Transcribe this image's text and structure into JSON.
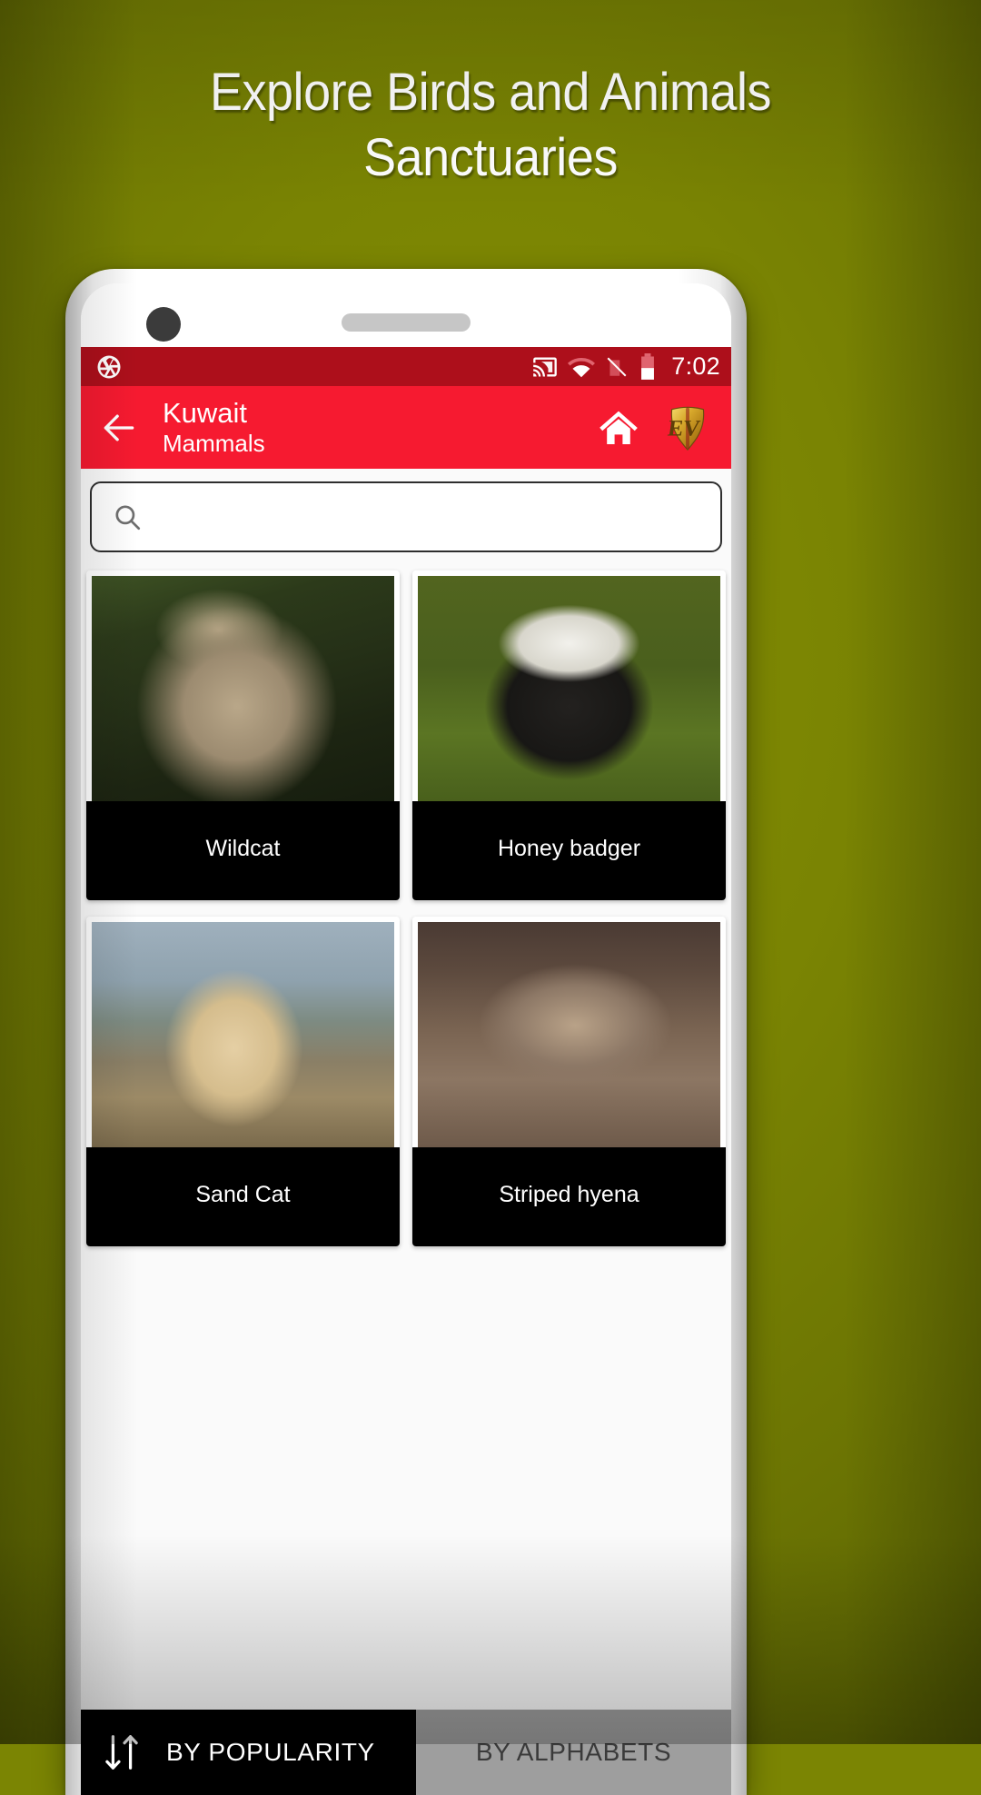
{
  "promo": {
    "headline": "Explore Birds and Animals\nSanctuaries",
    "background_color": "#7b8503"
  },
  "phone": {
    "camera_icon": "camera-dot",
    "speaker_icon": "speaker-grill"
  },
  "status_bar": {
    "background_color": "#ad0f1b",
    "app_icon": "aperture-icon",
    "icons": [
      "cast-icon",
      "wifi-icon",
      "signal-off-icon",
      "battery-icon"
    ],
    "clock": "7:02"
  },
  "app_bar": {
    "background_color": "#f61a30",
    "back_icon": "back-arrow-icon",
    "title": "Kuwait",
    "subtitle": "Mammals",
    "home_icon": "home-icon",
    "logo": "ev-shield-logo",
    "logo_text": "EV"
  },
  "search": {
    "icon": "search-icon",
    "value": "",
    "placeholder": ""
  },
  "grid": {
    "cards": [
      {
        "label": "Wildcat",
        "photo": "ph-wildcat"
      },
      {
        "label": "Honey badger",
        "photo": "ph-badger"
      },
      {
        "label": "Sand Cat",
        "photo": "ph-sandcat"
      },
      {
        "label": "Striped hyena",
        "photo": "ph-hyena"
      }
    ]
  },
  "sort_bar": {
    "sort_icon": "sort-arrows-icon",
    "by_popularity": "BY POPULARITY",
    "by_alphabets": "BY ALPHABETS",
    "active": "BY POPULARITY",
    "active_color": "#000000",
    "inactive_color": "#9e9e9e"
  }
}
